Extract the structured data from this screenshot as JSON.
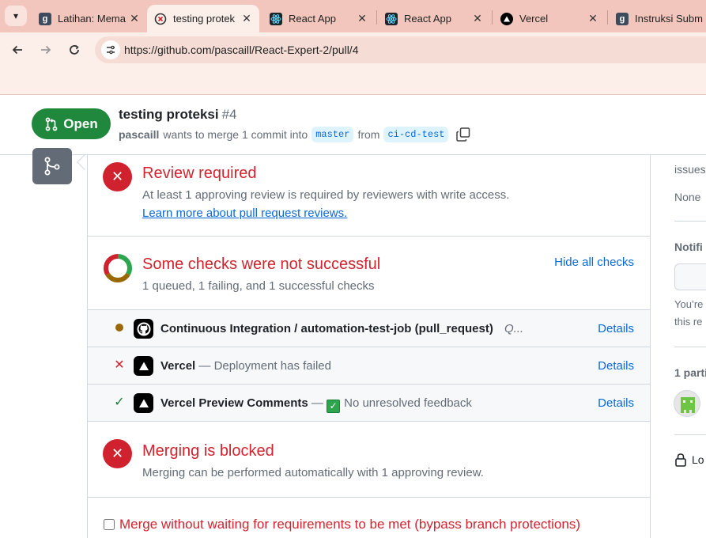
{
  "browser": {
    "tabs": [
      {
        "title": "Latihan: Mema",
        "favicon": "dicoding-icon",
        "active": false
      },
      {
        "title": "testing protek",
        "favicon": "github-loading-icon",
        "active": true
      },
      {
        "title": "React App",
        "favicon": "react-icon",
        "active": false
      },
      {
        "title": "React App",
        "favicon": "react-icon",
        "active": false
      },
      {
        "title": "Vercel",
        "favicon": "vercel-icon",
        "active": false
      },
      {
        "title": "Instruksi Subm",
        "favicon": "dicoding-icon",
        "active": false
      }
    ],
    "url": "https://github.com/pascaill/React-Expert-2/pull/4",
    "colors": {
      "tabstrip": "#f2c6bc",
      "toolbar": "#fcefe9"
    }
  },
  "pr": {
    "state": "Open",
    "title": "testing proteksi",
    "number": "#4",
    "author": "pascaill",
    "merge_text": "wants to merge 1 commit into",
    "base_branch": "master",
    "from_text": "from",
    "head_branch": "ci-cd-test"
  },
  "merge_box": {
    "review": {
      "title": "Review required",
      "desc": "At least 1 approving review is required by reviewers with write access.",
      "link": "Learn more about pull request reviews."
    },
    "checks": {
      "title": "Some checks were not successful",
      "summary": "1 queued, 1 failing, and 1 successful checks",
      "hide_label": "Hide all checks",
      "items": [
        {
          "status": "queued",
          "app": "github-icon",
          "name": "Continuous Integration / automation-test-job (pull_request)",
          "desc": "Q...",
          "details": "Details"
        },
        {
          "status": "failed",
          "app": "vercel-icon",
          "name": "Vercel",
          "desc": "Deployment has failed",
          "details": "Details"
        },
        {
          "status": "success",
          "app": "vercel-icon",
          "name": "Vercel Preview Comments",
          "desc": "No unresolved feedback",
          "details": "Details"
        }
      ]
    },
    "blocked": {
      "title": "Merging is blocked",
      "desc": "Merging can be performed automatically with 1 approving review."
    },
    "bypass_label": "Merge without waiting for requirements to be met (bypass branch protections)"
  },
  "sidebar": {
    "issues_label": "issues",
    "issues_value": "None",
    "notifications_label": "Notifi",
    "notif_text_1": "You’re",
    "notif_text_2": "this re",
    "participants_label": "1 parti",
    "lock_label": "Lo"
  },
  "colors": {
    "open_green": "#1f883d",
    "danger_red": "#cf222e",
    "link_blue": "#0969da",
    "queued_yellow": "#9a6700"
  }
}
